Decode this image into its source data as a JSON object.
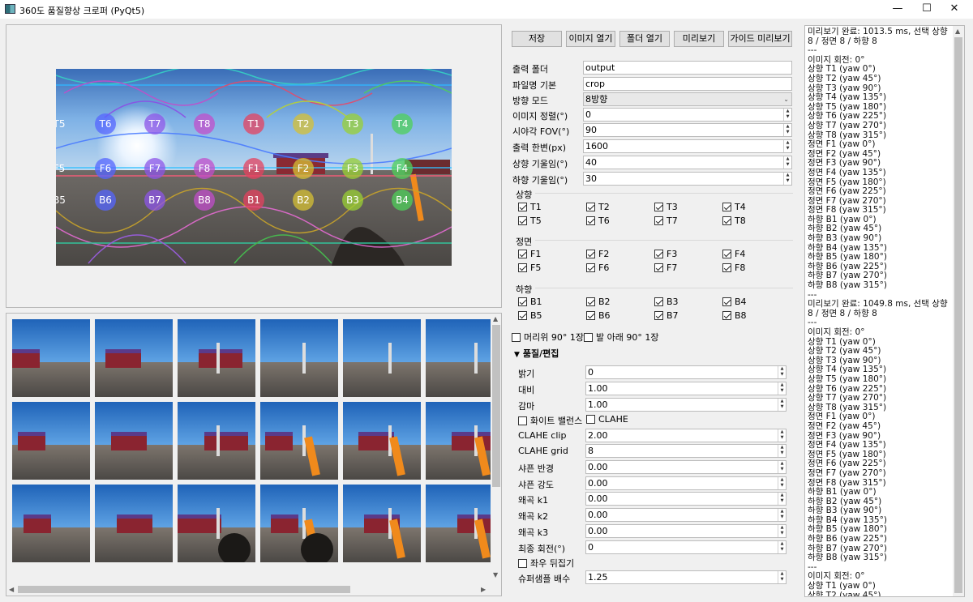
{
  "window": {
    "title": "360도 품질향상 크로퍼 (PyQt5)",
    "min_glyph": "—",
    "max_glyph": "☐",
    "close_glyph": "✕"
  },
  "toolbar": {
    "save": "저장",
    "open_image": "이미지 열기",
    "open_folder": "폴더 열기",
    "preview": "미리보기",
    "guide_preview": "가이드 미리보기"
  },
  "form": {
    "output_folder_label": "출력 폴더",
    "output_folder": "output",
    "filename_base_label": "파일명 기본",
    "filename_base": "crop",
    "direction_mode_label": "방향 모드",
    "direction_mode": "8방향",
    "image_align_label": "이미지 정렬(°)",
    "image_align": "0",
    "fov_label": "시야각 FOV(°)",
    "fov": "90",
    "output_side_label": "출력 한변(px)",
    "output_side": "1600",
    "up_tilt_label": "상향 기울임(°)",
    "up_tilt": "40",
    "down_tilt_label": "하향 기울임(°)",
    "down_tilt": "30"
  },
  "groups": {
    "up_title": "상향",
    "up": [
      "T1",
      "T2",
      "T3",
      "T4",
      "T5",
      "T6",
      "T7",
      "T8"
    ],
    "front_title": "정면",
    "front": [
      "F1",
      "F2",
      "F3",
      "F4",
      "F5",
      "F6",
      "F7",
      "F8"
    ],
    "down_title": "하향",
    "down": [
      "B1",
      "B2",
      "B3",
      "B4",
      "B5",
      "B6",
      "B7",
      "B8"
    ]
  },
  "extras": {
    "overhead": "머리위 90° 1장",
    "underfoot": "발 아래 90° 1장",
    "quality_section": "품질/편집"
  },
  "quality": {
    "brightness_label": "밝기",
    "brightness": "0",
    "contrast_label": "대비",
    "contrast": "1.00",
    "gamma_label": "감마",
    "gamma": "1.00",
    "white_balance": "화이트 밸런스",
    "clahe": "CLAHE",
    "clahe_clip_label": "CLAHE clip",
    "clahe_clip": "2.00",
    "clahe_grid_label": "CLAHE grid",
    "clahe_grid": "8",
    "sharpen_radius_label": "샤픈 반경",
    "sharpen_radius": "0.00",
    "sharpen_amount_label": "샤픈 강도",
    "sharpen_amount": "0.00",
    "k1_label": "왜곡 k1",
    "k1": "0.00",
    "k2_label": "왜곡 k2",
    "k2": "0.00",
    "k3_label": "왜곡 k3",
    "k3": "0.00",
    "final_rotate_label": "최종 회전(°)",
    "final_rotate": "0",
    "flip": "좌우 뒤집기",
    "supersample_label": "슈퍼샘플 배수",
    "supersample": "1.25"
  },
  "overlay_labels": {
    "row1": [
      "T5",
      "T6",
      "T7",
      "T8",
      "T1",
      "T2",
      "T3",
      "T4"
    ],
    "row2": [
      "F5",
      "F6",
      "F7",
      "F8",
      "F1",
      "F2",
      "F3",
      "F4"
    ],
    "row3": [
      "B5",
      "B6",
      "B7",
      "B8",
      "B1",
      "B2",
      "B3",
      "B4"
    ]
  },
  "log": "미리보기 완료: 1013.5 ms, 선택 상향 8 / 정면 8 / 하향 8\n---\n이미지 회전: 0°\n상향 T1 (yaw 0°)\n상향 T2 (yaw 45°)\n상향 T3 (yaw 90°)\n상향 T4 (yaw 135°)\n상향 T5 (yaw 180°)\n상향 T6 (yaw 225°)\n상향 T7 (yaw 270°)\n상향 T8 (yaw 315°)\n정면 F1 (yaw 0°)\n정면 F2 (yaw 45°)\n정면 F3 (yaw 90°)\n정면 F4 (yaw 135°)\n정면 F5 (yaw 180°)\n정면 F6 (yaw 225°)\n정면 F7 (yaw 270°)\n정면 F8 (yaw 315°)\n하향 B1 (yaw 0°)\n하향 B2 (yaw 45°)\n하향 B3 (yaw 90°)\n하향 B4 (yaw 135°)\n하향 B5 (yaw 180°)\n하향 B6 (yaw 225°)\n하향 B7 (yaw 270°)\n하향 B8 (yaw 315°)\n---\n미리보기 완료: 1049.8 ms, 선택 상향 8 / 정면 8 / 하향 8\n---\n이미지 회전: 0°\n상향 T1 (yaw 0°)\n상향 T2 (yaw 45°)\n상향 T3 (yaw 90°)\n상향 T4 (yaw 135°)\n상향 T5 (yaw 180°)\n상향 T6 (yaw 225°)\n상향 T7 (yaw 270°)\n상향 T8 (yaw 315°)\n정면 F1 (yaw 0°)\n정면 F2 (yaw 45°)\n정면 F3 (yaw 90°)\n정면 F4 (yaw 135°)\n정면 F5 (yaw 180°)\n정면 F6 (yaw 225°)\n정면 F7 (yaw 270°)\n정면 F8 (yaw 315°)\n하향 B1 (yaw 0°)\n하향 B2 (yaw 45°)\n하향 B3 (yaw 90°)\n하향 B4 (yaw 135°)\n하향 B5 (yaw 180°)\n하향 B6 (yaw 225°)\n하향 B7 (yaw 270°)\n하향 B8 (yaw 315°)\n---\n이미지 회전: 0°\n상향 T1 (yaw 0°)\n상향 T2 (yaw 45°)"
}
